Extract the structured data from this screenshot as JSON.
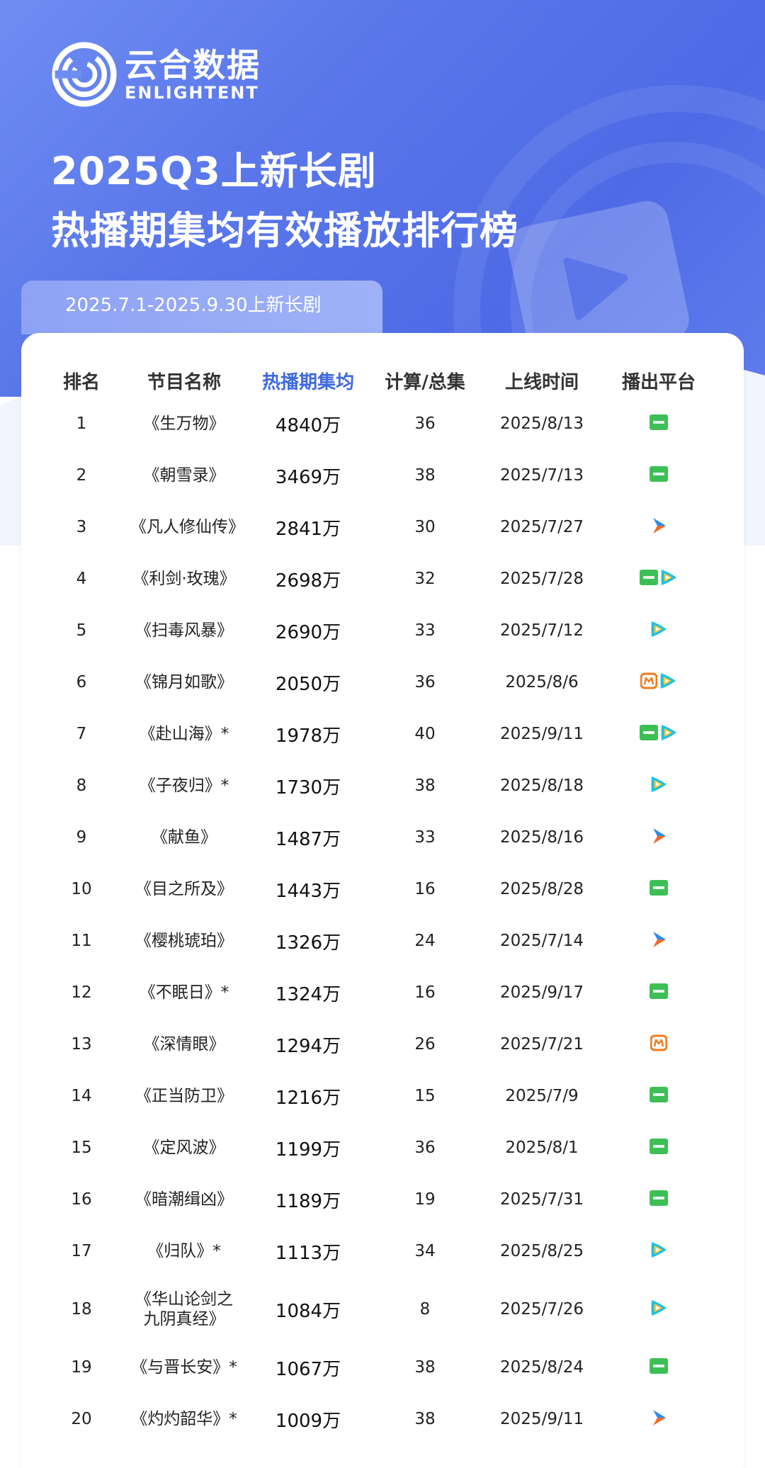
{
  "brand": {
    "cn": "云合数据",
    "en": "ENLIGHTENT"
  },
  "title": {
    "line1": "2025Q3上新长剧",
    "line2": "热播期集均有效播放排行榜"
  },
  "date_range": "2025.7.1-2025.9.30上新长剧",
  "table": {
    "headers": [
      "排名",
      "节目名称",
      "热播期集均",
      "计算/总集",
      "上线时间",
      "播出平台"
    ],
    "rows": [
      {
        "rank": "1",
        "name": "《生万物》",
        "value": "4840万",
        "episodes": "36",
        "date": "2025/8/13",
        "platforms": [
          "iqiyi-icon"
        ]
      },
      {
        "rank": "2",
        "name": "《朝雪录》",
        "value": "3469万",
        "episodes": "38",
        "date": "2025/7/13",
        "platforms": [
          "iqiyi-icon"
        ]
      },
      {
        "rank": "3",
        "name": "《凡人修仙传》",
        "value": "2841万",
        "episodes": "30",
        "date": "2025/7/27",
        "platforms": [
          "youku-icon"
        ]
      },
      {
        "rank": "4",
        "name": "《利剑·玫瑰》",
        "value": "2698万",
        "episodes": "32",
        "date": "2025/7/28",
        "platforms": [
          "iqiyi-icon",
          "tencent-video-icon"
        ]
      },
      {
        "rank": "5",
        "name": "《扫毒风暴》",
        "value": "2690万",
        "episodes": "33",
        "date": "2025/7/12",
        "platforms": [
          "tencent-video-icon"
        ]
      },
      {
        "rank": "6",
        "name": "《锦月如歌》",
        "value": "2050万",
        "episodes": "36",
        "date": "2025/8/6",
        "platforms": [
          "mango-tv-icon",
          "tencent-video-icon"
        ]
      },
      {
        "rank": "7",
        "name": "《赴山海》*",
        "value": "1978万",
        "episodes": "40",
        "date": "2025/9/11",
        "platforms": [
          "iqiyi-icon",
          "tencent-video-icon"
        ]
      },
      {
        "rank": "8",
        "name": "《子夜归》*",
        "value": "1730万",
        "episodes": "38",
        "date": "2025/8/18",
        "platforms": [
          "tencent-video-icon"
        ]
      },
      {
        "rank": "9",
        "name": "《献鱼》",
        "value": "1487万",
        "episodes": "33",
        "date": "2025/8/16",
        "platforms": [
          "youku-icon"
        ]
      },
      {
        "rank": "10",
        "name": "《目之所及》",
        "value": "1443万",
        "episodes": "16",
        "date": "2025/8/28",
        "platforms": [
          "iqiyi-icon"
        ]
      },
      {
        "rank": "11",
        "name": "《樱桃琥珀》",
        "value": "1326万",
        "episodes": "24",
        "date": "2025/7/14",
        "platforms": [
          "youku-icon"
        ]
      },
      {
        "rank": "12",
        "name": "《不眠日》*",
        "value": "1324万",
        "episodes": "16",
        "date": "2025/9/17",
        "platforms": [
          "iqiyi-icon"
        ]
      },
      {
        "rank": "13",
        "name": "《深情眼》",
        "value": "1294万",
        "episodes": "26",
        "date": "2025/7/21",
        "platforms": [
          "mango-tv-icon"
        ]
      },
      {
        "rank": "14",
        "name": "《正当防卫》",
        "value": "1216万",
        "episodes": "15",
        "date": "2025/7/9",
        "platforms": [
          "iqiyi-icon"
        ]
      },
      {
        "rank": "15",
        "name": "《定风波》",
        "value": "1199万",
        "episodes": "36",
        "date": "2025/8/1",
        "platforms": [
          "iqiyi-icon"
        ]
      },
      {
        "rank": "16",
        "name": "《暗潮缉凶》",
        "value": "1189万",
        "episodes": "19",
        "date": "2025/7/31",
        "platforms": [
          "iqiyi-icon"
        ]
      },
      {
        "rank": "17",
        "name": "《归队》*",
        "value": "1113万",
        "episodes": "34",
        "date": "2025/8/25",
        "platforms": [
          "tencent-video-icon"
        ]
      },
      {
        "rank": "18",
        "name": "《华山论剑之九阴真经》",
        "value": "1084万",
        "episodes": "8",
        "date": "2025/7/26",
        "platforms": [
          "tencent-video-icon"
        ]
      },
      {
        "rank": "19",
        "name": "《与晋长安》*",
        "value": "1067万",
        "episodes": "38",
        "date": "2025/8/24",
        "platforms": [
          "iqiyi-icon"
        ]
      },
      {
        "rank": "20",
        "name": "《灼灼韶华》*",
        "value": "1009万",
        "episodes": "38",
        "date": "2025/9/11",
        "platforms": [
          "youku-icon"
        ]
      }
    ]
  },
  "colors": {
    "header_blue": "#4e6be6",
    "highlight_header": "#3f6ae0",
    "iqiyi": "#3dbf55",
    "mango": "#f07a1c",
    "youku_a": "#2b8cf0",
    "youku_b": "#f0692b",
    "tencent_a": "#1fc1e3",
    "tencent_b": "#ffc52b",
    "tencent_c": "#1a8cf0"
  }
}
